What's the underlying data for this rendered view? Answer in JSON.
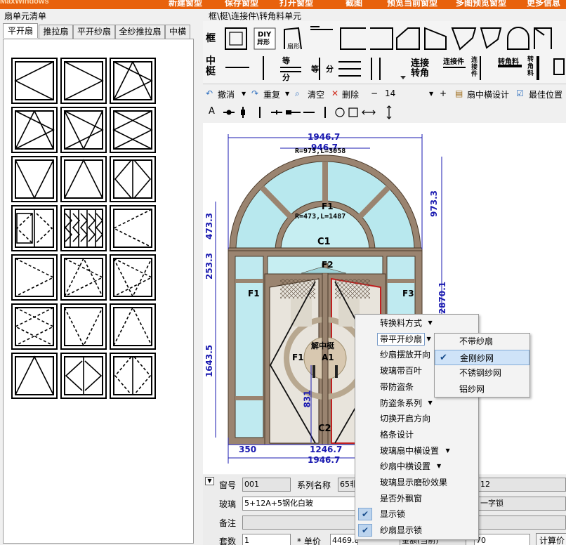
{
  "topbar": {
    "logo": "MaxWindows",
    "buttons": [
      "新建窗型",
      "保存窗型",
      "打开窗型",
      "截图",
      "预览当前窗型",
      "多图预览窗型",
      "更多信息"
    ],
    "color": "#e8620c"
  },
  "left": {
    "title": "扇单元清单",
    "tabs": [
      "平开扇",
      "推拉扇",
      "平开纱扇",
      "全纱推拉扇",
      "中横"
    ],
    "active_tab": 0
  },
  "right": {
    "title": "框\\梃\\连接件\\转角料单元",
    "row1_label": "框",
    "row2_label": "中梃",
    "diy_label": "DIY",
    "diy_sub": "异形",
    "frame_label": "扇形",
    "row2": {
      "deng": "等",
      "fen": "分",
      "fen2": "分",
      "lianjie": "连接",
      "zhuanjiao": "转角",
      "ljj": "连接件",
      "ljj2": "连接件",
      "zjl": "转角料",
      "zjl2": "转角料"
    }
  },
  "toolbar2": {
    "undo": "撤消",
    "redo": "重复",
    "clear": "清空",
    "delete": "删除",
    "minus": "−",
    "size": "14",
    "plus": "+",
    "sash_design": "扇中横设计",
    "best_position": "最佳位置"
  },
  "toolbar3": {
    "text_tool": "A"
  },
  "drawing": {
    "width_top": "1946.7",
    "width_top2": "946.7",
    "arc_label": "R=973,L=3058",
    "f1_top": "F1",
    "inner_arc": "R=473,L=1487",
    "c1": "C1",
    "f2": "F2",
    "f1_left": "F1",
    "f3": "F3",
    "f1_mid": "F1",
    "a1": "A1",
    "center_text": "解中梃",
    "c2": "C2",
    "dim_350": "350",
    "dim_1246": "1246.7",
    "dim_bottom": "1946.7",
    "dim_473": "473.3",
    "dim_253": "253.3",
    "dim_1643": "1643.5",
    "dim_831": "831",
    "dim_973": "973.3",
    "dim_2870": "2870.1"
  },
  "form": {
    "window_no_label": "窗号",
    "window_no": "001",
    "series_label": "系列名称",
    "series_value": "65非",
    "right_value1": "12",
    "glass_label": "玻璃",
    "glass_value": "5+12A+5钢化白玻",
    "lock_value": "一字锁",
    "note_label": "备注",
    "note_value": "",
    "qty_label": "套数",
    "qty_value": "1",
    "price_label": "* 单价",
    "price_value": "4469.8",
    "misc_value": "金额(当前)",
    "misc2": "70",
    "calc_button": "计算价"
  },
  "context_menu": {
    "items": [
      {
        "label": "转换料方式",
        "submenu": true
      },
      {
        "label": "带平开纱扇",
        "submenu": true,
        "highlight": true
      },
      {
        "label": "纱扇摆放开向"
      },
      {
        "label": "玻璃带百叶"
      },
      {
        "label": "带防盗条"
      },
      {
        "label": "防盗条系列",
        "submenu": true
      },
      {
        "label": "切换开启方向"
      },
      {
        "label": "格条设计"
      },
      {
        "label": "玻璃扇中横设置",
        "submenu": true
      },
      {
        "label": "纱扇中横设置",
        "submenu": true
      },
      {
        "label": "玻璃显示磨砂效果"
      },
      {
        "label": "是否外飘窗"
      },
      {
        "label": "显示锁",
        "checked": true
      },
      {
        "label": "纱扇显示锁",
        "checked": true
      }
    ],
    "submenu": [
      {
        "label": "不带纱扇"
      },
      {
        "label": "金刚纱网",
        "checked": true
      },
      {
        "label": "不锈钢纱网"
      },
      {
        "label": "铝纱网"
      }
    ],
    "check_mark": "✔",
    "arrow": "▸"
  }
}
